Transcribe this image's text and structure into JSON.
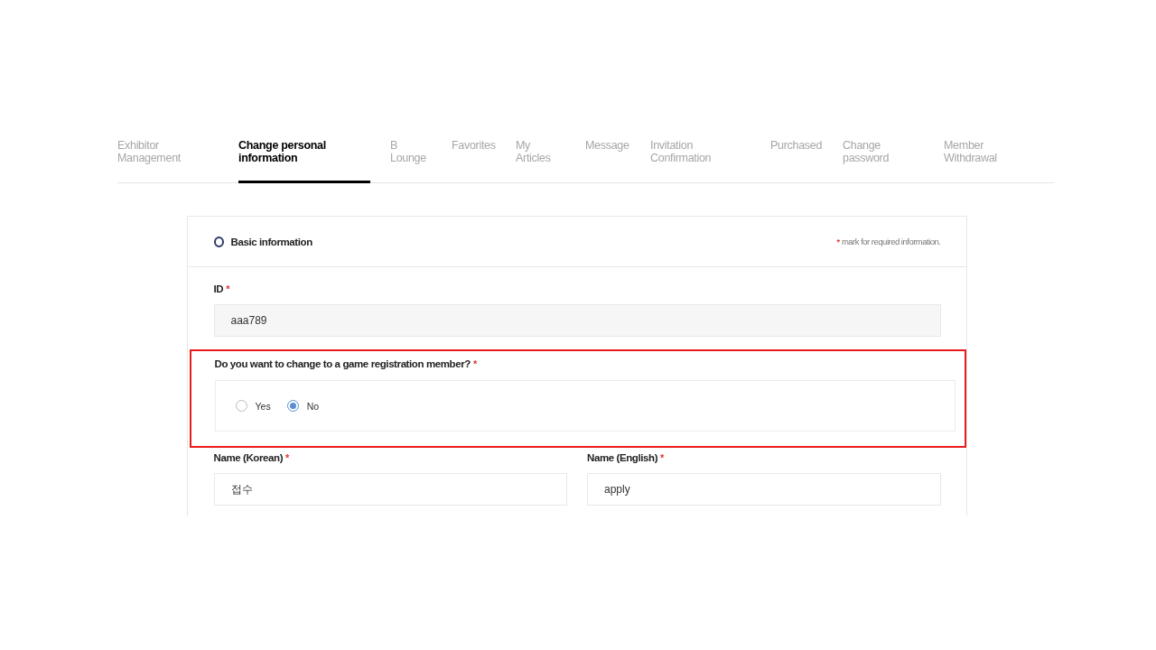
{
  "tabs": [
    {
      "label": "Exhibitor\nManagement",
      "selected": false
    },
    {
      "label": "Change personal\ninformation",
      "selected": true
    },
    {
      "label": "B\nLounge",
      "selected": false
    },
    {
      "label": "Favorites",
      "selected": false
    },
    {
      "label": "My\nArticles",
      "selected": false
    },
    {
      "label": "Message",
      "selected": false
    },
    {
      "label": "Invitation\nConfirmation",
      "selected": false
    },
    {
      "label": "Purchased",
      "selected": false
    },
    {
      "label": "Change\npassword",
      "selected": false
    },
    {
      "label": "Member\nWithdrawal",
      "selected": false
    }
  ],
  "section": {
    "title": "Basic information",
    "required_note_mark": "*",
    "required_note": "mark for required information."
  },
  "id_field": {
    "label": "ID",
    "required_mark": "*",
    "value": "aaa789"
  },
  "question": {
    "label": "Do you want to change to a game registration member?",
    "required_mark": "*",
    "highlighted": true,
    "options": [
      {
        "label": "Yes",
        "selected": false
      },
      {
        "label": "No",
        "selected": true
      }
    ]
  },
  "name_fields": [
    {
      "label": "Name (Korean)",
      "required_mark": "*",
      "value": "접수"
    },
    {
      "label": "Name (English)",
      "required_mark": "*",
      "value": "apply"
    }
  ]
}
